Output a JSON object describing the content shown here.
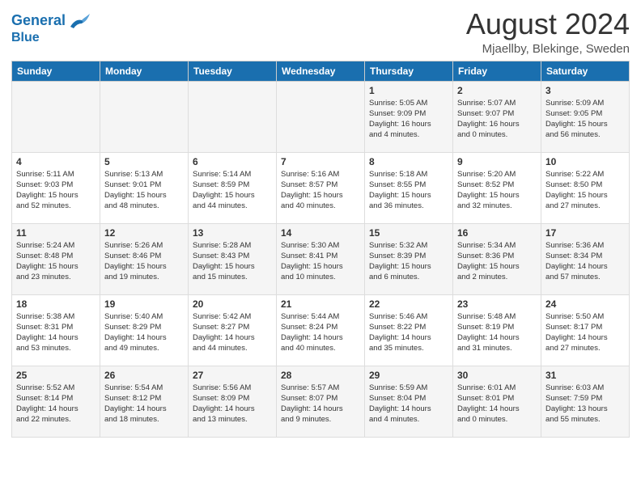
{
  "logo": {
    "line1": "General",
    "line2": "Blue"
  },
  "title": "August 2024",
  "location": "Mjaellby, Blekinge, Sweden",
  "weekdays": [
    "Sunday",
    "Monday",
    "Tuesday",
    "Wednesday",
    "Thursday",
    "Friday",
    "Saturday"
  ],
  "weeks": [
    [
      {
        "day": "",
        "info": ""
      },
      {
        "day": "",
        "info": ""
      },
      {
        "day": "",
        "info": ""
      },
      {
        "day": "",
        "info": ""
      },
      {
        "day": "1",
        "info": "Sunrise: 5:05 AM\nSunset: 9:09 PM\nDaylight: 16 hours\nand 4 minutes."
      },
      {
        "day": "2",
        "info": "Sunrise: 5:07 AM\nSunset: 9:07 PM\nDaylight: 16 hours\nand 0 minutes."
      },
      {
        "day": "3",
        "info": "Sunrise: 5:09 AM\nSunset: 9:05 PM\nDaylight: 15 hours\nand 56 minutes."
      }
    ],
    [
      {
        "day": "4",
        "info": "Sunrise: 5:11 AM\nSunset: 9:03 PM\nDaylight: 15 hours\nand 52 minutes."
      },
      {
        "day": "5",
        "info": "Sunrise: 5:13 AM\nSunset: 9:01 PM\nDaylight: 15 hours\nand 48 minutes."
      },
      {
        "day": "6",
        "info": "Sunrise: 5:14 AM\nSunset: 8:59 PM\nDaylight: 15 hours\nand 44 minutes."
      },
      {
        "day": "7",
        "info": "Sunrise: 5:16 AM\nSunset: 8:57 PM\nDaylight: 15 hours\nand 40 minutes."
      },
      {
        "day": "8",
        "info": "Sunrise: 5:18 AM\nSunset: 8:55 PM\nDaylight: 15 hours\nand 36 minutes."
      },
      {
        "day": "9",
        "info": "Sunrise: 5:20 AM\nSunset: 8:52 PM\nDaylight: 15 hours\nand 32 minutes."
      },
      {
        "day": "10",
        "info": "Sunrise: 5:22 AM\nSunset: 8:50 PM\nDaylight: 15 hours\nand 27 minutes."
      }
    ],
    [
      {
        "day": "11",
        "info": "Sunrise: 5:24 AM\nSunset: 8:48 PM\nDaylight: 15 hours\nand 23 minutes."
      },
      {
        "day": "12",
        "info": "Sunrise: 5:26 AM\nSunset: 8:46 PM\nDaylight: 15 hours\nand 19 minutes."
      },
      {
        "day": "13",
        "info": "Sunrise: 5:28 AM\nSunset: 8:43 PM\nDaylight: 15 hours\nand 15 minutes."
      },
      {
        "day": "14",
        "info": "Sunrise: 5:30 AM\nSunset: 8:41 PM\nDaylight: 15 hours\nand 10 minutes."
      },
      {
        "day": "15",
        "info": "Sunrise: 5:32 AM\nSunset: 8:39 PM\nDaylight: 15 hours\nand 6 minutes."
      },
      {
        "day": "16",
        "info": "Sunrise: 5:34 AM\nSunset: 8:36 PM\nDaylight: 15 hours\nand 2 minutes."
      },
      {
        "day": "17",
        "info": "Sunrise: 5:36 AM\nSunset: 8:34 PM\nDaylight: 14 hours\nand 57 minutes."
      }
    ],
    [
      {
        "day": "18",
        "info": "Sunrise: 5:38 AM\nSunset: 8:31 PM\nDaylight: 14 hours\nand 53 minutes."
      },
      {
        "day": "19",
        "info": "Sunrise: 5:40 AM\nSunset: 8:29 PM\nDaylight: 14 hours\nand 49 minutes."
      },
      {
        "day": "20",
        "info": "Sunrise: 5:42 AM\nSunset: 8:27 PM\nDaylight: 14 hours\nand 44 minutes."
      },
      {
        "day": "21",
        "info": "Sunrise: 5:44 AM\nSunset: 8:24 PM\nDaylight: 14 hours\nand 40 minutes."
      },
      {
        "day": "22",
        "info": "Sunrise: 5:46 AM\nSunset: 8:22 PM\nDaylight: 14 hours\nand 35 minutes."
      },
      {
        "day": "23",
        "info": "Sunrise: 5:48 AM\nSunset: 8:19 PM\nDaylight: 14 hours\nand 31 minutes."
      },
      {
        "day": "24",
        "info": "Sunrise: 5:50 AM\nSunset: 8:17 PM\nDaylight: 14 hours\nand 27 minutes."
      }
    ],
    [
      {
        "day": "25",
        "info": "Sunrise: 5:52 AM\nSunset: 8:14 PM\nDaylight: 14 hours\nand 22 minutes."
      },
      {
        "day": "26",
        "info": "Sunrise: 5:54 AM\nSunset: 8:12 PM\nDaylight: 14 hours\nand 18 minutes."
      },
      {
        "day": "27",
        "info": "Sunrise: 5:56 AM\nSunset: 8:09 PM\nDaylight: 14 hours\nand 13 minutes."
      },
      {
        "day": "28",
        "info": "Sunrise: 5:57 AM\nSunset: 8:07 PM\nDaylight: 14 hours\nand 9 minutes."
      },
      {
        "day": "29",
        "info": "Sunrise: 5:59 AM\nSunset: 8:04 PM\nDaylight: 14 hours\nand 4 minutes."
      },
      {
        "day": "30",
        "info": "Sunrise: 6:01 AM\nSunset: 8:01 PM\nDaylight: 14 hours\nand 0 minutes."
      },
      {
        "day": "31",
        "info": "Sunrise: 6:03 AM\nSunset: 7:59 PM\nDaylight: 13 hours\nand 55 minutes."
      }
    ]
  ]
}
